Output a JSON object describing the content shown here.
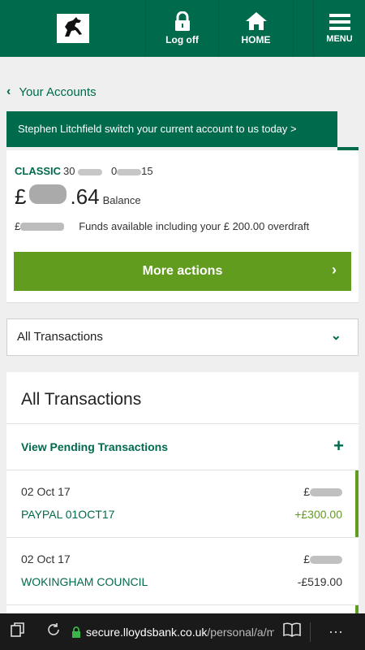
{
  "header": {
    "logoff_label": "Log off",
    "home_label": "HOME",
    "menu_label": "MENU",
    "logo_icon": "black-horse-logo-icon",
    "bg_color": "#006a4d"
  },
  "nav": {
    "back_label": "Your Accounts"
  },
  "promo": {
    "text": "Stephen Litchfield switch your current account to us today >"
  },
  "account": {
    "name": "CLASSIC",
    "sort_prefix": "30",
    "acct_prefix": "0",
    "acct_suffix": "15",
    "balance_pound": "£",
    "balance_tail": ".64",
    "balance_label": "Balance",
    "funds_pound": "£",
    "funds_text": "Funds available including your £ 200.00  overdraft",
    "more_actions_label": "More actions",
    "more_actions_color": "#629c1f"
  },
  "filter": {
    "selected": "All Transactions"
  },
  "transactions": {
    "title": "All Transactions",
    "pending_label": "View Pending Transactions",
    "items": [
      {
        "date": "02 Oct 17",
        "desc": "PAYPAL 01OCT17",
        "balance_prefix": "£",
        "amount": "+£300.00",
        "amount_color": "#629c1f"
      },
      {
        "date": "02 Oct 17",
        "desc": "WOKINGHAM COUNCIL",
        "balance_prefix": "£",
        "amount": "-£519.00",
        "amount_color": "#333333"
      }
    ]
  },
  "browser": {
    "url_host": "secure.lloydsbank.co.uk",
    "url_path": "/personal/a/mo"
  }
}
